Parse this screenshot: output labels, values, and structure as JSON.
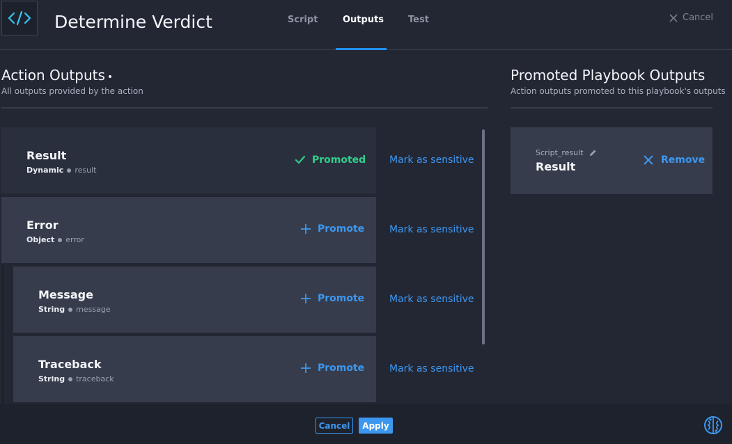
{
  "header": {
    "title": "Determine Verdict",
    "tabs": [
      {
        "label": "Script",
        "active": false
      },
      {
        "label": "Outputs",
        "active": true
      },
      {
        "label": "Test",
        "active": false
      }
    ],
    "cancel_label": "Cancel"
  },
  "action_outputs": {
    "title": "Action Outputs",
    "subtitle": "All outputs provided by the action",
    "rows": [
      {
        "name": "Result",
        "type": "Dynamic",
        "key": "result",
        "status": "Promoted",
        "sensitive_label": "Mark as sensitive"
      },
      {
        "name": "Error",
        "type": "Object",
        "key": "error",
        "status": "Promote",
        "sensitive_label": "Mark as sensitive"
      },
      {
        "name": "Message",
        "type": "String",
        "key": "message",
        "status": "Promote",
        "sensitive_label": "Mark as sensitive"
      },
      {
        "name": "Traceback",
        "type": "String",
        "key": "traceback",
        "status": "Promote",
        "sensitive_label": "Mark as sensitive"
      }
    ]
  },
  "promoted_outputs": {
    "title": "Promoted Playbook Outputs",
    "subtitle": "Action outputs promoted to this playbook's outputs",
    "items": [
      {
        "alias": "Script_result",
        "name": "Result",
        "remove_label": "Remove"
      }
    ]
  },
  "footer": {
    "cancel_label": "Cancel",
    "apply_label": "Apply"
  },
  "colors": {
    "accent": "#3c97f0",
    "promoted": "#2fcf8a",
    "background": "#232734",
    "card": "#363c4c"
  },
  "icons": {
    "logo": "code-icon",
    "close": "close-icon",
    "promoted": "check-icon",
    "promote": "plus-icon",
    "edit": "pencil-icon",
    "remove": "x-icon",
    "assistant": "brain-icon"
  }
}
